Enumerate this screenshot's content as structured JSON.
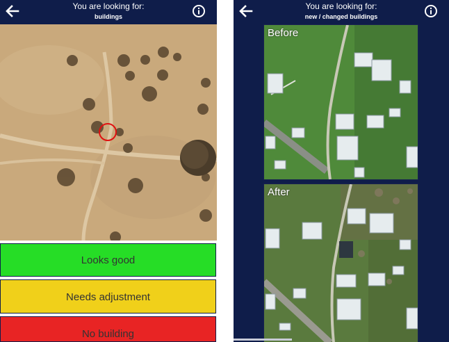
{
  "left_screen": {
    "header": {
      "title": "You are looking for:",
      "subtitle": "buildings",
      "back_icon": "arrow-left-icon",
      "info_icon": "info-icon"
    },
    "buttons": {
      "looks_good": "Looks good",
      "needs_adjustment": "Needs adjustment",
      "no_building": "No building"
    },
    "colors": {
      "looks_good": "#26dd26",
      "needs_adjustment": "#f0d01a",
      "no_building": "#e82424",
      "header_bg": "#0f1d4a"
    }
  },
  "right_screen": {
    "header": {
      "title": "You are looking for:",
      "subtitle": "new / changed buildings",
      "back_icon": "arrow-left-icon",
      "info_icon": "info-icon"
    },
    "panels": {
      "before_label": "Before",
      "after_label": "After"
    }
  }
}
